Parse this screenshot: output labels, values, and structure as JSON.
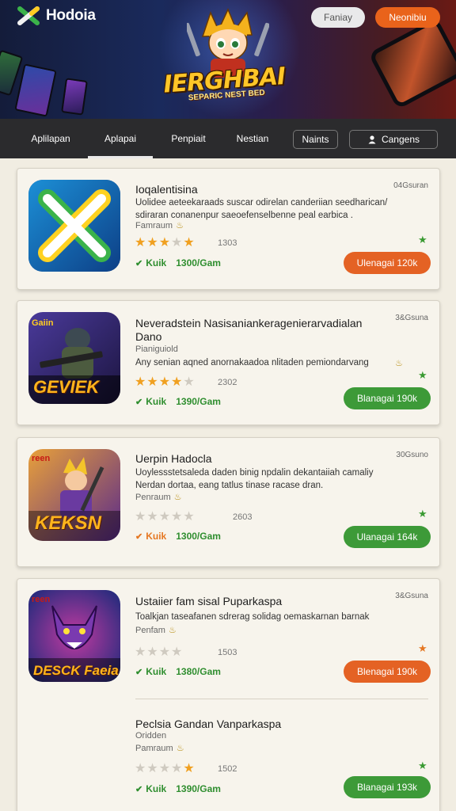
{
  "app": {
    "title": "Hodoia"
  },
  "header": {
    "buttons": [
      "Faniay",
      "Neonibiu"
    ]
  },
  "hero": {
    "logo_main": "IERGHBAI",
    "logo_sub": "SEPARIC NEST BED"
  },
  "nav": {
    "tabs": [
      "Aplilapan",
      "Aplapai",
      "Penpiait",
      "Nestian"
    ],
    "active_tab": 1,
    "buttons": [
      "Naints",
      "Cangens"
    ]
  },
  "apps": [
    {
      "title": "Ioqalentisina",
      "size": "04Gsuran",
      "desc": [
        "Uolidee aeteekaraads suscar odirelan canderiian seedharican/",
        "sdiraran conanenpur saeoefenselbenne peal earbica ."
      ],
      "meta": "Famraum",
      "rating": 3,
      "rating_count": "1303",
      "stat_label": "Kuik",
      "stat_value": "1300/Gam",
      "action": "Ulenagai 120k",
      "action_color": "orange"
    },
    {
      "title": "Neveradstein Nasisaniankeragenierarvadialan Dano",
      "size": "3&Gsuna",
      "desc": [
        "Any senian aqned anornakaadoa nlitaden pemiondarvang"
      ],
      "meta": "Pianiguiold",
      "rating": 4,
      "rating_count": "2302",
      "stat_label": "Kuik",
      "stat_value": "1390/Gam",
      "action": "Blanagai 190k",
      "action_color": "green"
    },
    {
      "title": "Uerpin Hadocla",
      "size": "30Gsuno",
      "desc": [
        "Uoylessstetsaleda daden binig npdalin dekantaiiah camaliy",
        "Nerdan dortaa, eang tatlus tinase racase dran."
      ],
      "meta": "Penraum",
      "rating": 0,
      "rating_count": "2603",
      "stat_label": "Kuik",
      "stat_value": "1300/Gam",
      "action": "Ulanagai 164k",
      "action_color": "green"
    },
    {
      "title": "Ustaiier fam sisal Puparkaspa",
      "size": "3&Gsuna",
      "desc": [
        "Toalkjan taseafanen sdrerag solidag oemaskarnan barnak"
      ],
      "meta": "Penfam",
      "rating": 0,
      "rating_count": "1503",
      "stat_label": "Kuik",
      "stat_value": "1380/Gam",
      "action": "Blenagai 190k",
      "action_color": "orange"
    },
    {
      "title": "Peclsia Gandan Vanparkaspa",
      "size": "",
      "desc": [],
      "meta": "Oridden",
      "meta2": "Pamraum",
      "rating": 1,
      "rating_count": "1502",
      "stat_label": "Kuik",
      "stat_value": "1390/Gam",
      "action": "Blanagai 193k",
      "action_color": "green"
    }
  ],
  "icon_labels": {
    "app2_badge": "Gaiin",
    "app2_art": "GEVIEK",
    "app3_badge": "reen",
    "app3_art": "KEKSN",
    "app4_badge": "reen",
    "app4_art": "DESCK Faeia"
  },
  "colors": {
    "accent_orange": "#e46224",
    "accent_green": "#3d9a38",
    "nav_bg": "#2b2b2d",
    "page_bg": "#f1ede2"
  }
}
